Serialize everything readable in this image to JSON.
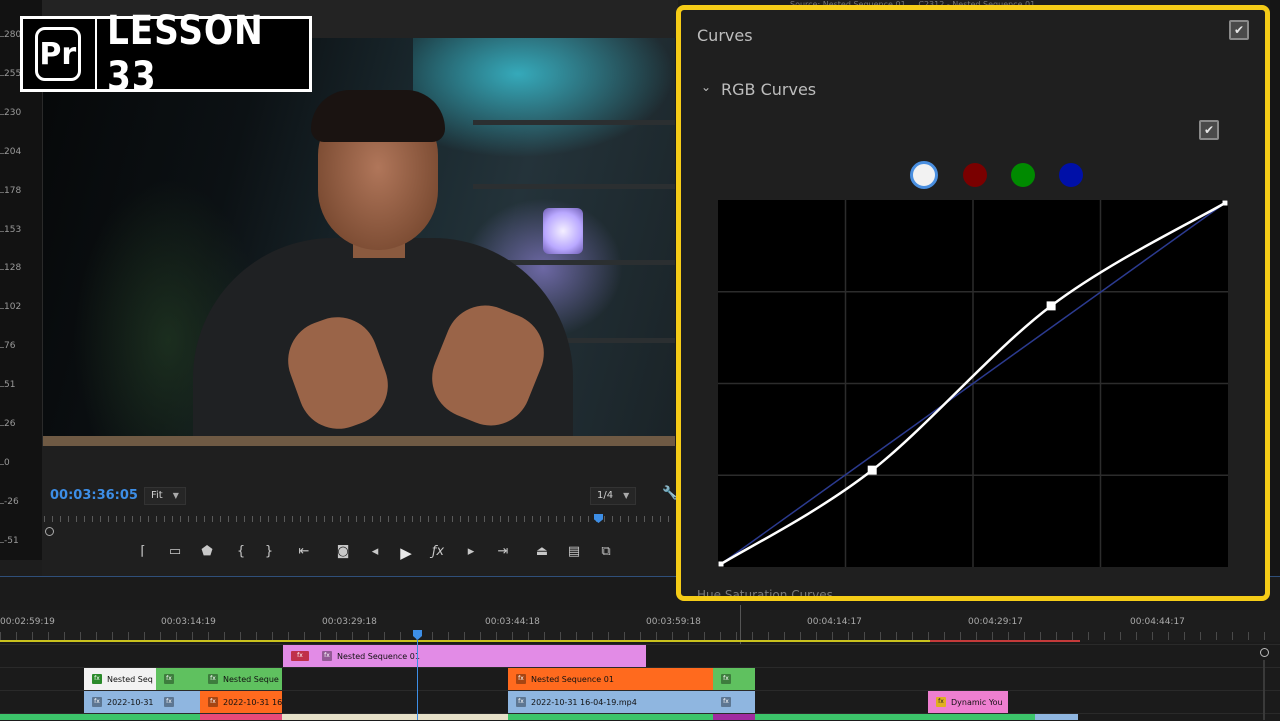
{
  "overlay": {
    "logo_icon": "Pr",
    "lesson_label": "LESSON 33"
  },
  "scope": {
    "labels": [
      "280",
      "255",
      "230",
      "204",
      "178",
      "153",
      "128",
      "102",
      "76",
      "51",
      "26",
      "0",
      "-26",
      "-51"
    ]
  },
  "monitor": {
    "timecode": "00:03:36:05",
    "zoom_select": "Fit",
    "resolution_select": "1/4",
    "controls": [
      "mark-in",
      "mark-out",
      "add-marker",
      "mark-in-point",
      "mark-out-point",
      "go-to-in",
      "export-frame",
      "step-back",
      "play",
      "fx",
      "step-forward",
      "go-to-out",
      "lift",
      "extract",
      "compare"
    ]
  },
  "behind_panel_title": "Source: Nested Sequence 01 ... C2312 - Nested Sequence 01",
  "curves_panel": {
    "title": "Curves",
    "enabled": true,
    "section": "RGB Curves",
    "section_enabled": true,
    "selected_channel": "white",
    "channels": [
      {
        "name": "white",
        "color": "#f2f2f2"
      },
      {
        "name": "red",
        "color": "#7a0000"
      },
      {
        "name": "green",
        "color": "#008a00"
      },
      {
        "name": "blue",
        "color": "#0010a8"
      }
    ],
    "curve_points": [
      [
        0,
        0
      ],
      [
        0.3,
        0.26
      ],
      [
        0.655,
        0.715
      ],
      [
        1,
        1
      ]
    ],
    "accent_color": "#f5cc17",
    "bottom_partial_label": "Hue Saturation Curves"
  },
  "timeline": {
    "timecodes": [
      "00:02:59:19",
      "00:03:14:19",
      "00:03:29:18",
      "00:03:44:18",
      "00:03:59:18",
      "00:04:14:17",
      "00:04:29:17",
      "00:04:44:17"
    ],
    "clips": {
      "c1": "Nested Sequence 01",
      "c2": "Nested Seq",
      "c3": "Nested Seque",
      "c4": "Nested Sequence 01",
      "c5": "2022-10-31",
      "c6": "2022-10-31 16",
      "c7": "2022-10-31 16-04-19.mp4",
      "c8": "Dynamic You"
    }
  }
}
